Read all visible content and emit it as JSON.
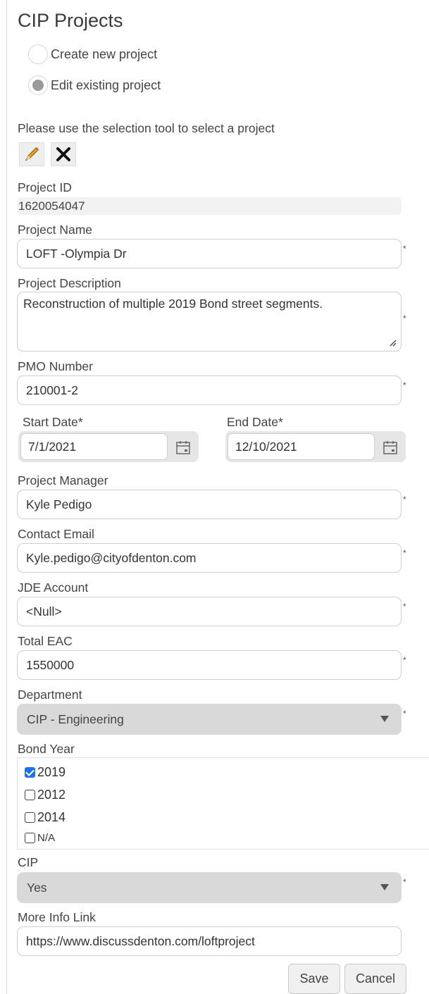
{
  "title": "CIP Projects",
  "mode": {
    "create_label": "Create new project",
    "edit_label": "Edit existing project",
    "selected": "edit"
  },
  "selection_hint": "Please use the selection tool to select a project",
  "tools": [
    "pencil-icon",
    "close-icon"
  ],
  "required_marker": "*",
  "project_id": {
    "label": "Project ID",
    "value": "1620054047"
  },
  "project_name": {
    "label": "Project Name",
    "value": "LOFT -Olympia Dr"
  },
  "project_description": {
    "label": "Project Description",
    "value": "Reconstruction of multiple 2019 Bond street segments."
  },
  "pmo_number": {
    "label": "PMO Number",
    "value": "210001-2"
  },
  "start_date": {
    "label": "Start Date*",
    "value": "7/1/2021"
  },
  "end_date": {
    "label": "End Date*",
    "value": "12/10/2021"
  },
  "project_manager": {
    "label": "Project Manager",
    "value": "Kyle Pedigo"
  },
  "contact_email": {
    "label": "Contact Email",
    "value": "Kyle.pedigo@cityofdenton.com"
  },
  "jde_account": {
    "label": "JDE Account",
    "value": "<Null>"
  },
  "total_eac": {
    "label": "Total EAC",
    "value": "1550000"
  },
  "department": {
    "label": "Department",
    "value": "CIP - Engineering"
  },
  "bond_year": {
    "label": "Bond Year",
    "options": [
      {
        "label": "2019",
        "checked": true
      },
      {
        "label": "2012",
        "checked": false
      },
      {
        "label": "2014",
        "checked": false
      },
      {
        "label": "N/A",
        "checked": false
      }
    ]
  },
  "cip": {
    "label": "CIP",
    "value": "Yes"
  },
  "more_info": {
    "label": "More Info Link",
    "value": "https://www.discussdenton.com/loftproject"
  },
  "buttons": {
    "save": "Save",
    "cancel": "Cancel"
  },
  "colors": {
    "checkbox_checked": "#1a73e8",
    "select_bg": "#d9d9d9",
    "readonly_bg": "#f2f2f2"
  }
}
